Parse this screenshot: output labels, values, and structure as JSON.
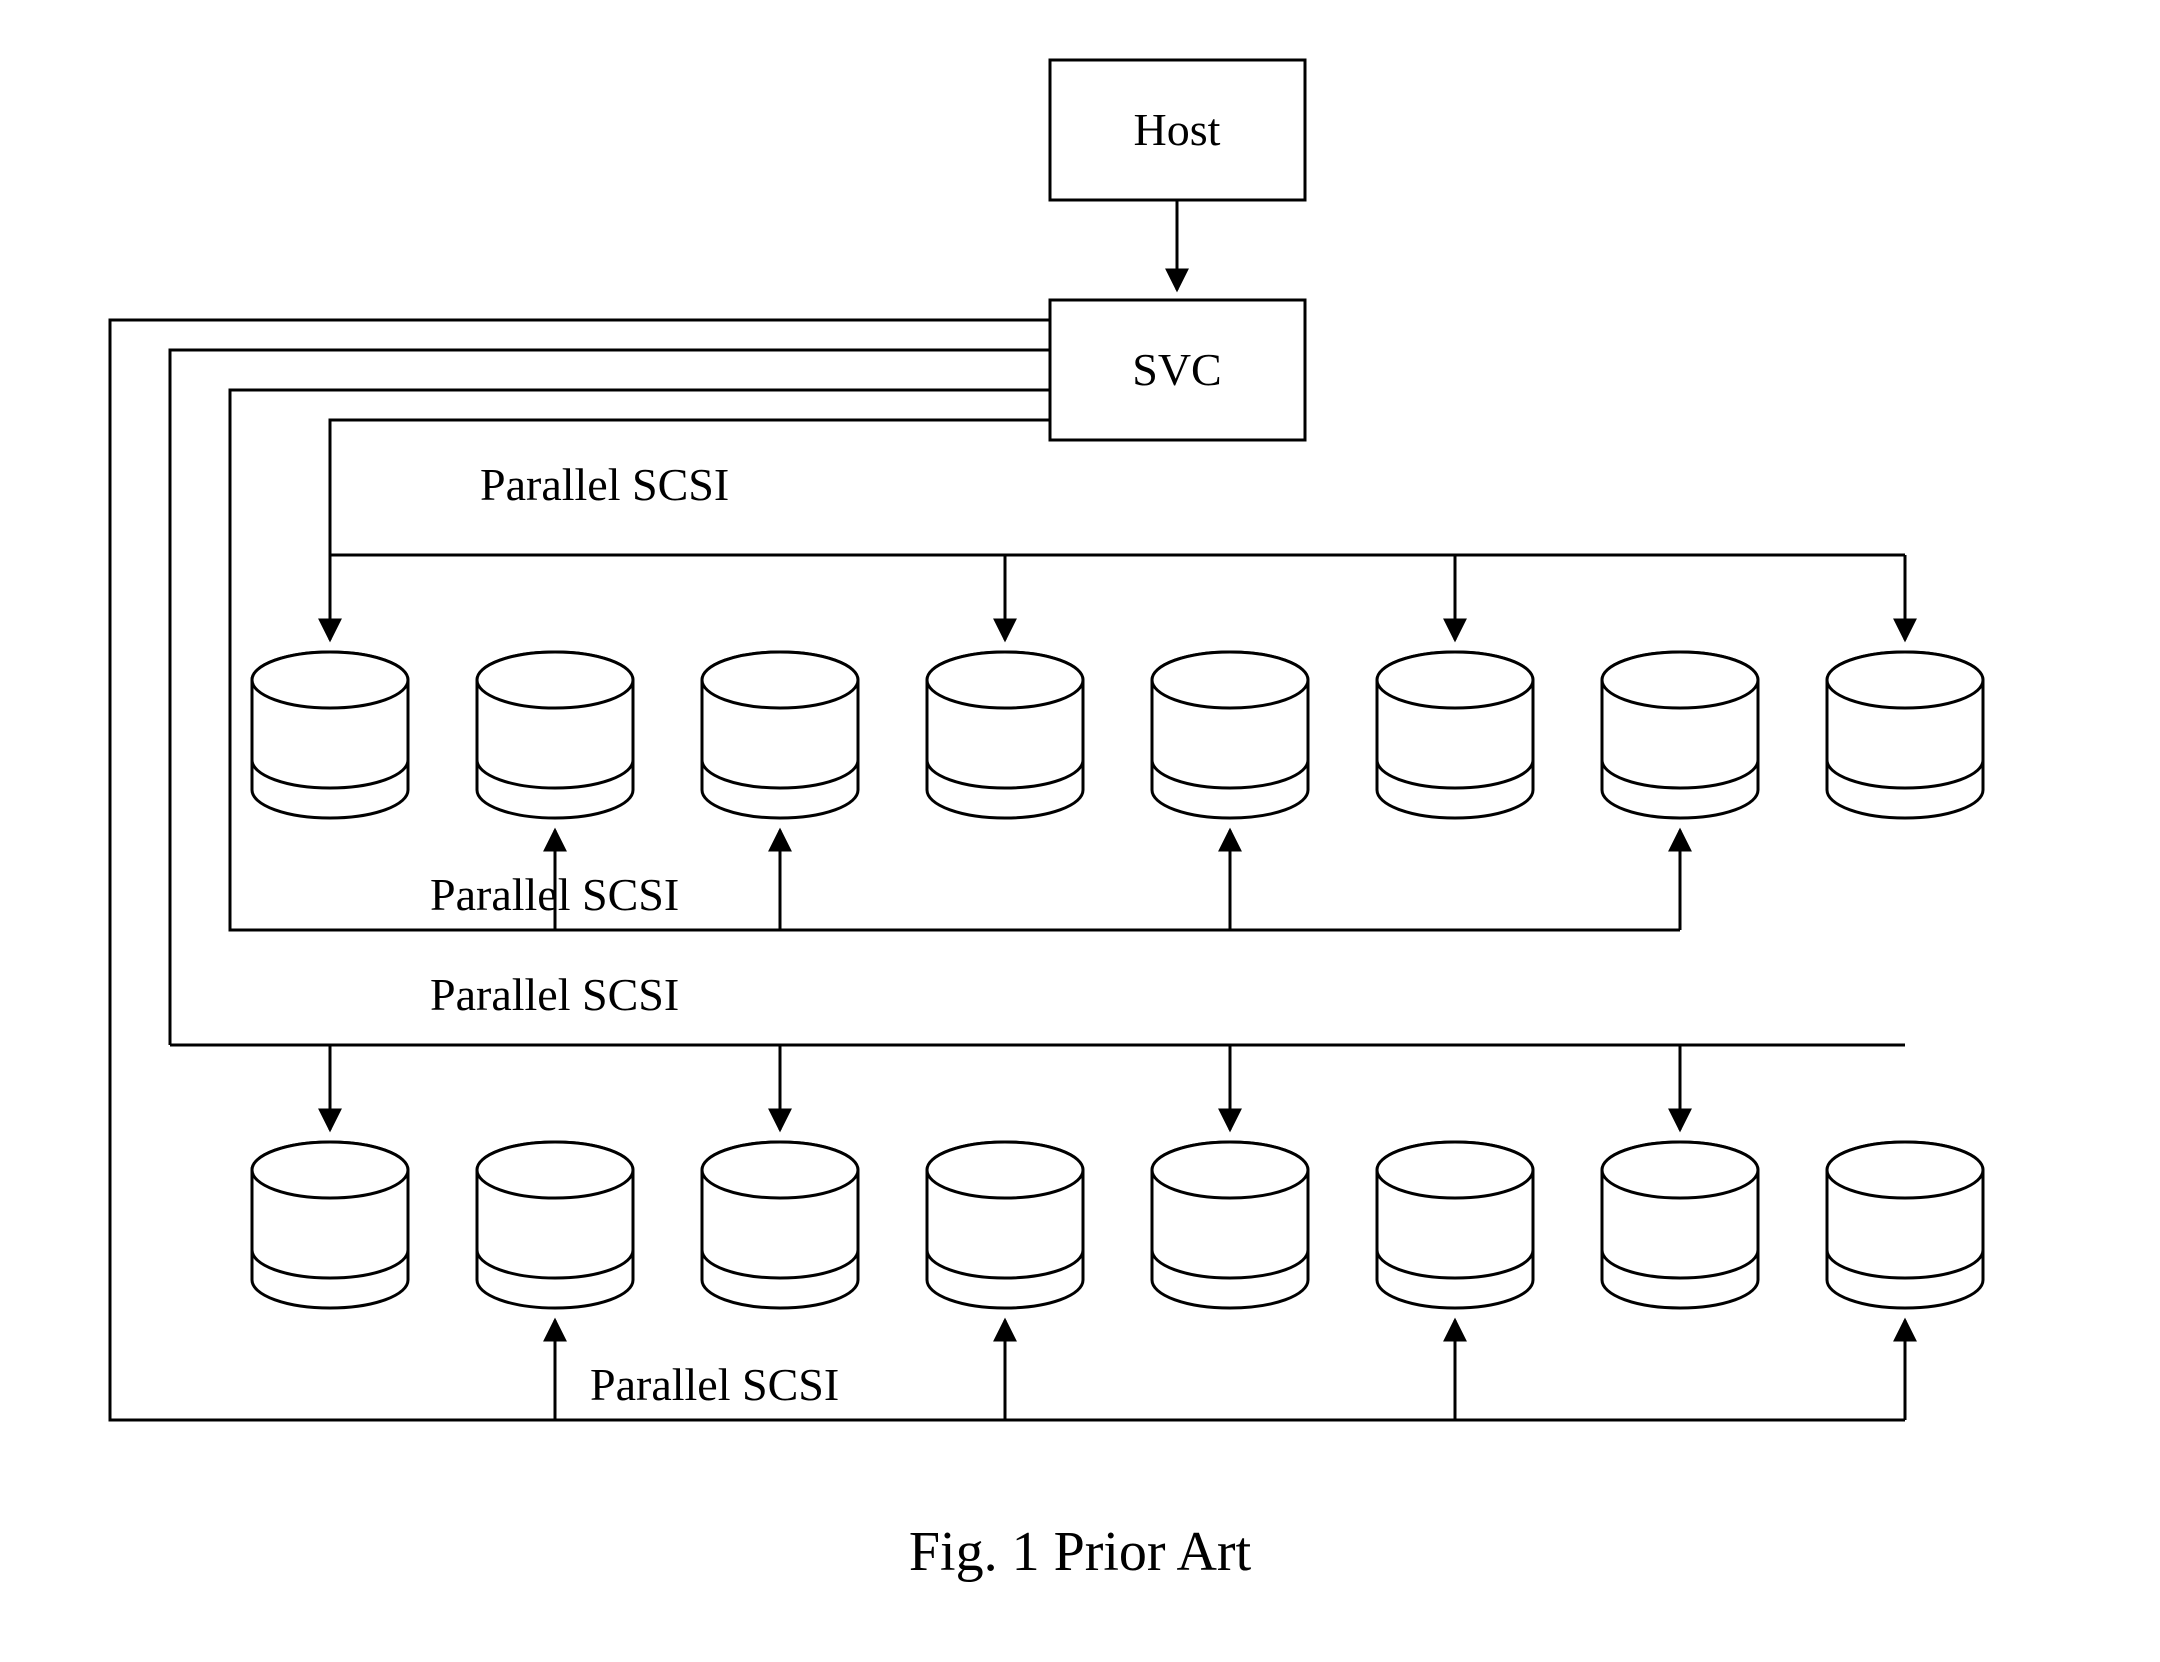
{
  "host_label": "Host",
  "svc_label": "SVC",
  "bus1_label": "Parallel SCSI",
  "bus2_label": "Parallel SCSI",
  "bus3_label": "Parallel SCSI",
  "bus4_label": "Parallel SCSI",
  "caption": "Fig. 1 Prior Art"
}
